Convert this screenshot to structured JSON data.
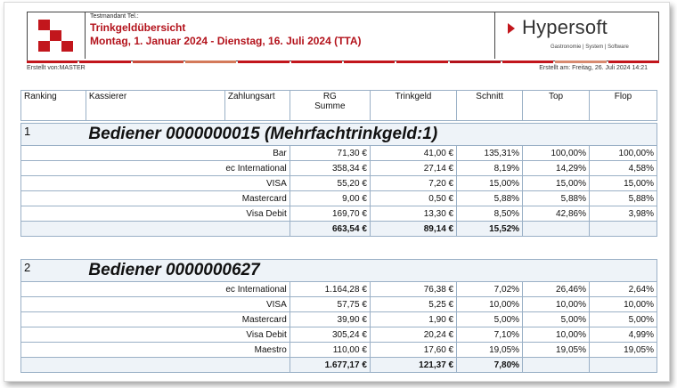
{
  "header": {
    "tel": "Testmandant Tel.:",
    "title": "Trinkgeldübersicht",
    "date_range": "Montag, 1. Januar 2024 - Dienstag, 16. Juli 2024 (TTA)",
    "brand": "Hypersoft",
    "brand_sub": "Gastronomie | System | Software",
    "created_by": "Erstellt von:MASTER",
    "created_at": "Erstellt am: Freitag, 26. Juli 2024 14:21"
  },
  "colors": {
    "accent": "#b3121b",
    "grid": "#9ab0c6",
    "group_bg": "#eef3f8"
  },
  "columns": [
    "Ranking",
    "Kassierer",
    "Zahlungsart",
    "RG Summe",
    "Trinkgeld",
    "Schnitt",
    "Top",
    "Flop"
  ],
  "groups": [
    {
      "rank": "1",
      "name": "Bediener 0000000015 (Mehrfachtrinkgeld:1)",
      "rows": [
        {
          "pay": "Bar",
          "rg": "71,30 €",
          "tip": "41,00 €",
          "avg": "135,31%",
          "top": "100,00%",
          "flop": "100,00%"
        },
        {
          "pay": "ec International",
          "rg": "358,34 €",
          "tip": "27,14 €",
          "avg": "8,19%",
          "top": "14,29%",
          "flop": "4,58%"
        },
        {
          "pay": "VISA",
          "rg": "55,20 €",
          "tip": "7,20 €",
          "avg": "15,00%",
          "top": "15,00%",
          "flop": "15,00%"
        },
        {
          "pay": "Mastercard",
          "rg": "9,00 €",
          "tip": "0,50 €",
          "avg": "5,88%",
          "top": "5,88%",
          "flop": "5,88%"
        },
        {
          "pay": "Visa Debit",
          "rg": "169,70 €",
          "tip": "13,30 €",
          "avg": "8,50%",
          "top": "42,86%",
          "flop": "3,98%"
        }
      ],
      "sum": {
        "rg": "663,54 €",
        "tip": "89,14 €",
        "avg": "15,52%"
      }
    },
    {
      "rank": "2",
      "name": "Bediener 0000000627",
      "rows": [
        {
          "pay": "ec International",
          "rg": "1.164,28 €",
          "tip": "76,38 €",
          "avg": "7,02%",
          "top": "26,46%",
          "flop": "2,64%"
        },
        {
          "pay": "VISA",
          "rg": "57,75 €",
          "tip": "5,25 €",
          "avg": "10,00%",
          "top": "10,00%",
          "flop": "10,00%"
        },
        {
          "pay": "Mastercard",
          "rg": "39,90 €",
          "tip": "1,90 €",
          "avg": "5,00%",
          "top": "5,00%",
          "flop": "5,00%"
        },
        {
          "pay": "Visa Debit",
          "rg": "305,24 €",
          "tip": "20,24 €",
          "avg": "7,10%",
          "top": "10,00%",
          "flop": "4,99%"
        },
        {
          "pay": "Maestro",
          "rg": "110,00 €",
          "tip": "17,60 €",
          "avg": "19,05%",
          "top": "19,05%",
          "flop": "19,05%"
        }
      ],
      "sum": {
        "rg": "1.677,17 €",
        "tip": "121,37 €",
        "avg": "7,80%"
      }
    }
  ]
}
